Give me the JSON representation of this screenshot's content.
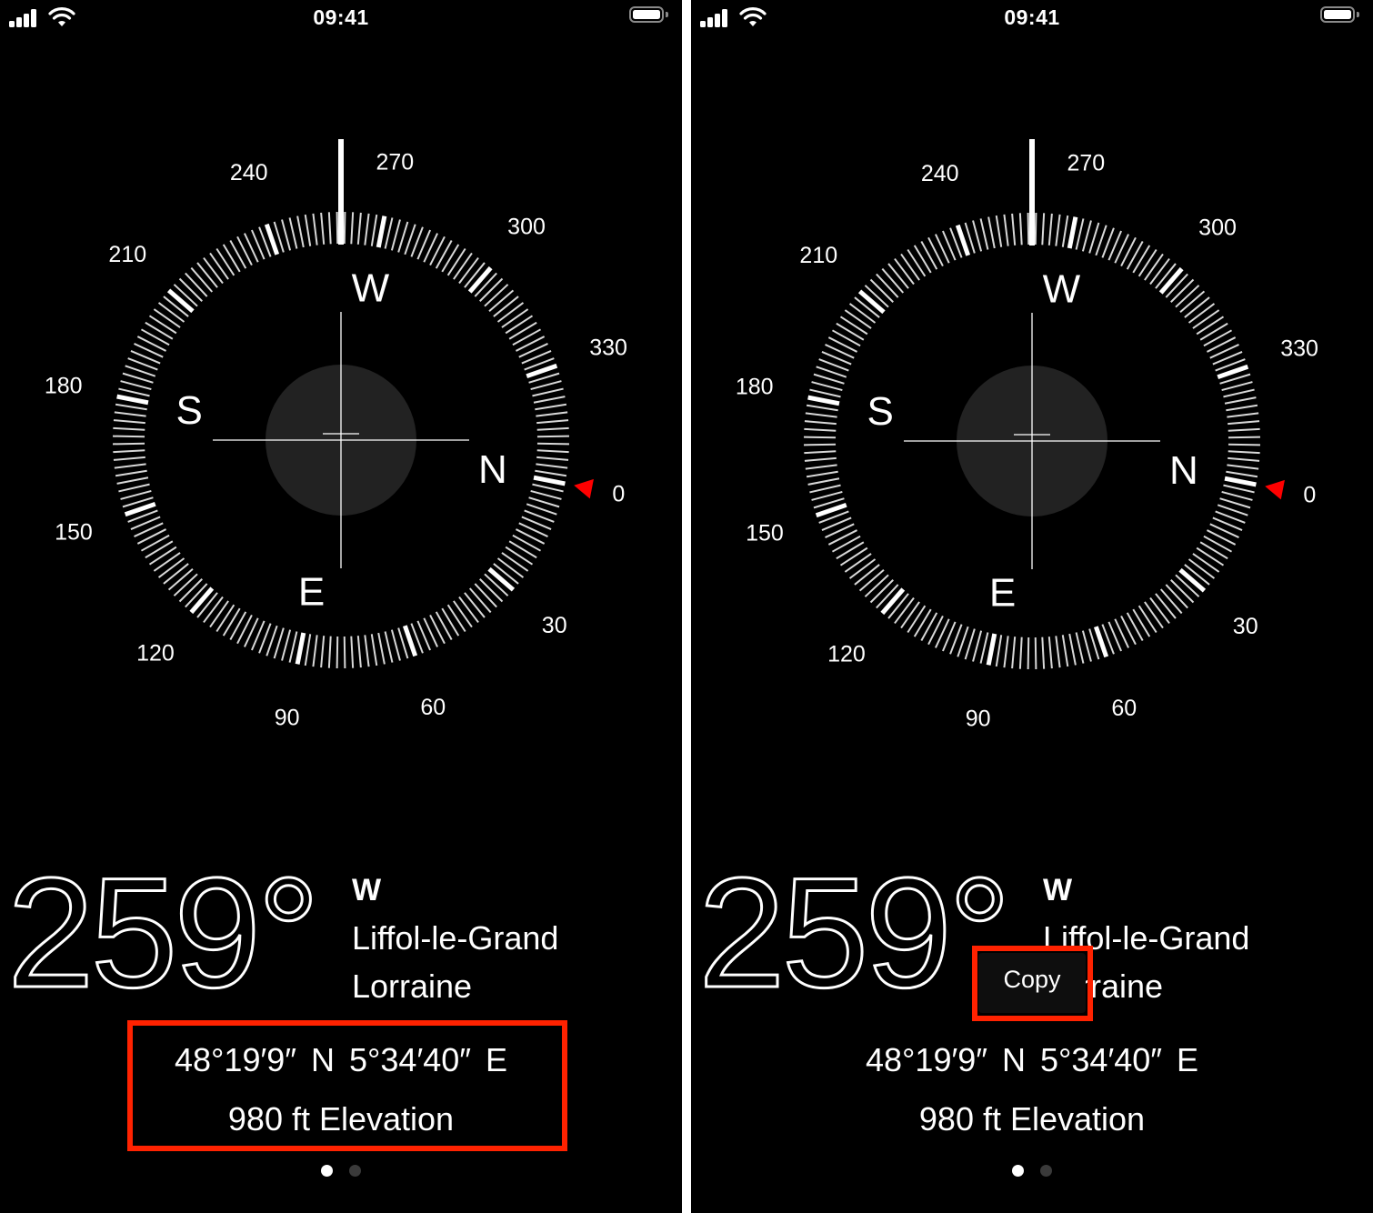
{
  "status_bar": {
    "time": "09:41",
    "signal_icon": "cellular-signal-icon",
    "wifi_icon": "wifi-icon",
    "battery_icon": "battery-full-icon",
    "signal_bars": 4,
    "battery_level": 1.0
  },
  "compass": {
    "heading_degrees": 259,
    "degree_labels": [
      "0",
      "30",
      "60",
      "90",
      "120",
      "150",
      "180",
      "210",
      "240",
      "270",
      "300",
      "330"
    ],
    "cardinals": [
      {
        "label": "N",
        "bearing": 0
      },
      {
        "label": "E",
        "bearing": 90
      },
      {
        "label": "S",
        "bearing": 180
      },
      {
        "label": "W",
        "bearing": 270
      }
    ],
    "north_indicator_color": "#ff0000",
    "level_circle_color": "#222222",
    "north_indicator_icon": "red-triangle-icon"
  },
  "readout": {
    "heading": "259°",
    "direction": "W",
    "place_line1": "Liffol-le-Grand",
    "place_line2": "Lorraine",
    "coordinates": "48°19′9″ N  5°34′40″ E",
    "elevation": "980 ft Elevation"
  },
  "page_indicator": {
    "total": 2,
    "current": 1
  },
  "context_menu": {
    "copy_label": "Copy"
  },
  "annotation": {
    "highlight_color": "#ff2200"
  }
}
